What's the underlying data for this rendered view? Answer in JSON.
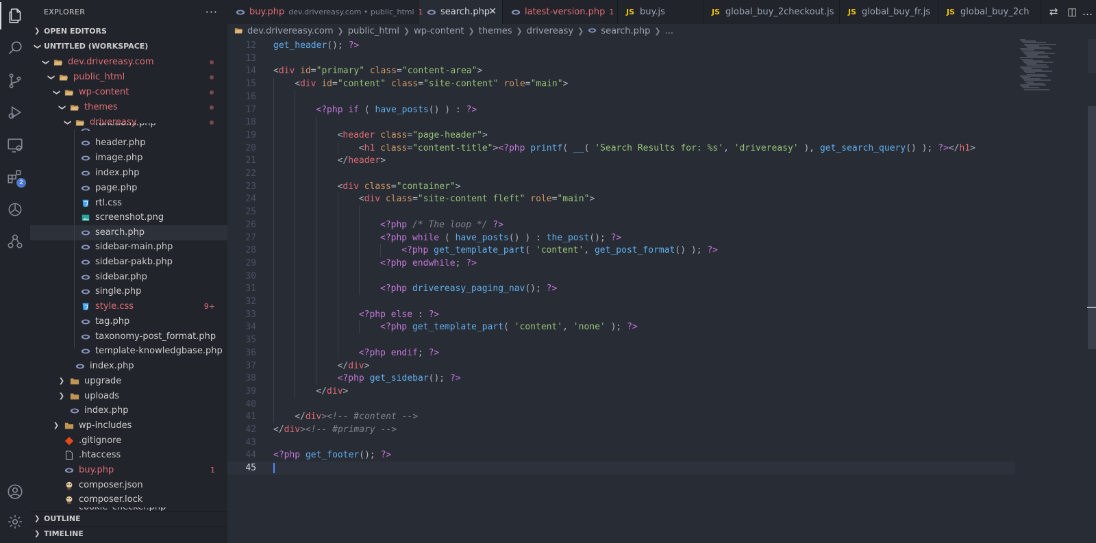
{
  "activity_bar": {
    "items": [
      {
        "name": "explorer-icon",
        "active": true
      },
      {
        "name": "search-icon"
      },
      {
        "name": "source-control-icon"
      },
      {
        "name": "run-debug-icon"
      },
      {
        "name": "remote-explorer-icon"
      },
      {
        "name": "extensions-icon",
        "badge": "2"
      },
      {
        "name": "chatgpt-icon"
      },
      {
        "name": "bug-tree-icon"
      }
    ],
    "bottom": [
      {
        "name": "account-icon"
      },
      {
        "name": "settings-gear-icon"
      }
    ]
  },
  "sidebar": {
    "title": "EXPLORER",
    "more": "···",
    "open_editors": "OPEN EDITORS",
    "workspace": "UNTITLED (WORKSPACE)",
    "tree": [
      {
        "label": "dev.drivereasy.com",
        "type": "folder-open",
        "depth": 1,
        "mod": true,
        "dot": true
      },
      {
        "label": "public_html",
        "type": "folder-open",
        "depth": 2,
        "mod": true,
        "dot": true
      },
      {
        "label": "wp-content",
        "type": "folder-open",
        "depth": 3,
        "mod": true,
        "dot": true
      },
      {
        "label": "themes",
        "type": "folder-open",
        "depth": 4,
        "mod": true,
        "dot": true
      },
      {
        "label": "drivereasy",
        "type": "folder-open",
        "depth": 5,
        "mod": true,
        "dot": true
      },
      {
        "label": "functions.php",
        "type": "php",
        "depth": 6,
        "partial": true
      },
      {
        "label": "header.php",
        "type": "php",
        "depth": 6
      },
      {
        "label": "image.php",
        "type": "php",
        "depth": 6
      },
      {
        "label": "index.php",
        "type": "php",
        "depth": 6
      },
      {
        "label": "page.php",
        "type": "php",
        "depth": 6
      },
      {
        "label": "rtl.css",
        "type": "css",
        "depth": 6
      },
      {
        "label": "screenshot.png",
        "type": "png",
        "depth": 6
      },
      {
        "label": "search.php",
        "type": "php",
        "depth": 6,
        "active": true
      },
      {
        "label": "sidebar-main.php",
        "type": "php",
        "depth": 6
      },
      {
        "label": "sidebar-pakb.php",
        "type": "php",
        "depth": 6
      },
      {
        "label": "sidebar.php",
        "type": "php",
        "depth": 6
      },
      {
        "label": "single.php",
        "type": "php",
        "depth": 6
      },
      {
        "label": "style.css",
        "type": "css",
        "depth": 6,
        "mod": true,
        "count": "9+"
      },
      {
        "label": "tag.php",
        "type": "php",
        "depth": 6
      },
      {
        "label": "taxonomy-post_format.php",
        "type": "php",
        "depth": 6
      },
      {
        "label": "template-knowledgbase.php",
        "type": "php",
        "depth": 6
      },
      {
        "label": "index.php",
        "type": "php",
        "depth": 5
      },
      {
        "label": "upgrade",
        "type": "folder",
        "depth": 4
      },
      {
        "label": "uploads",
        "type": "folder",
        "depth": 4
      },
      {
        "label": "index.php",
        "type": "php",
        "depth": 4
      },
      {
        "label": "wp-includes",
        "type": "folder",
        "depth": 3
      },
      {
        "label": ".gitignore",
        "type": "git",
        "depth": 3
      },
      {
        "label": ".htaccess",
        "type": "file",
        "depth": 3
      },
      {
        "label": "buy.php",
        "type": "php",
        "depth": 3,
        "mod": true,
        "count": "1"
      },
      {
        "label": "composer.json",
        "type": "composer",
        "depth": 3
      },
      {
        "label": "composer.lock",
        "type": "composer",
        "depth": 3
      },
      {
        "label": "cookie_checker.php",
        "type": "php",
        "depth": 3,
        "partial": true
      }
    ],
    "outline": "OUTLINE",
    "timeline": "TIMELINE"
  },
  "tabs": [
    {
      "name": "buy.php",
      "desc": "dev.drivereasy.com • public_html",
      "num": "1",
      "icon": "php",
      "mod": true
    },
    {
      "name": "search.php",
      "icon": "php",
      "active": true,
      "close": "✕"
    },
    {
      "name": "latest-version.php",
      "num": "1",
      "icon": "php",
      "mod": true
    },
    {
      "name": "buy.js",
      "icon": "js"
    },
    {
      "name": "global_buy_2checkout.js",
      "icon": "js"
    },
    {
      "name": "global_buy_fr.js",
      "icon": "js"
    },
    {
      "name": "global_buy_2ch",
      "icon": "js"
    }
  ],
  "js_badge": "JS",
  "breadcrumb": [
    "dev.drivereasy.com",
    "public_html",
    "wp-content",
    "themes",
    "drivereasy",
    "search.php",
    "..."
  ],
  "editor": {
    "current_line": "45",
    "lines": [
      {
        "n": "12",
        "indent": 0,
        "toks": [
          [
            "t-fn",
            "get_header"
          ],
          [
            "t-pl",
            "(); "
          ],
          [
            "t-kw",
            "?>"
          ]
        ]
      },
      {
        "n": "13",
        "indent": 0,
        "toks": []
      },
      {
        "n": "14",
        "indent": 0,
        "toks": [
          [
            "t-pl",
            "<"
          ],
          [
            "t-tag",
            "div"
          ],
          [
            "t-pl",
            " "
          ],
          [
            "t-attr",
            "id"
          ],
          [
            "t-pl",
            "="
          ],
          [
            "t-str",
            "\"primary\""
          ],
          [
            "t-pl",
            " "
          ],
          [
            "t-attr",
            "class"
          ],
          [
            "t-pl",
            "="
          ],
          [
            "t-str",
            "\"content-area\""
          ],
          [
            "t-pl",
            ">"
          ]
        ]
      },
      {
        "n": "15",
        "indent": 1,
        "toks": [
          [
            "t-pl",
            "<"
          ],
          [
            "t-tag",
            "div"
          ],
          [
            "t-pl",
            " "
          ],
          [
            "t-attr",
            "id"
          ],
          [
            "t-pl",
            "="
          ],
          [
            "t-str",
            "\"content\""
          ],
          [
            "t-pl",
            " "
          ],
          [
            "t-attr",
            "class"
          ],
          [
            "t-pl",
            "="
          ],
          [
            "t-str",
            "\"site-content\""
          ],
          [
            "t-pl",
            " "
          ],
          [
            "t-attr",
            "role"
          ],
          [
            "t-pl",
            "="
          ],
          [
            "t-str",
            "\"main\""
          ],
          [
            "t-pl",
            ">"
          ]
        ]
      },
      {
        "n": "16",
        "indent": 2,
        "toks": []
      },
      {
        "n": "17",
        "indent": 2,
        "toks": [
          [
            "t-kw",
            "<?php"
          ],
          [
            "t-pl",
            " "
          ],
          [
            "t-kw",
            "if"
          ],
          [
            "t-pl",
            " ( "
          ],
          [
            "t-fn",
            "have_posts"
          ],
          [
            "t-pl",
            "() ) : "
          ],
          [
            "t-kw",
            "?>"
          ]
        ]
      },
      {
        "n": "18",
        "indent": 3,
        "toks": []
      },
      {
        "n": "19",
        "indent": 3,
        "toks": [
          [
            "t-pl",
            "<"
          ],
          [
            "t-tag",
            "header"
          ],
          [
            "t-pl",
            " "
          ],
          [
            "t-attr",
            "class"
          ],
          [
            "t-pl",
            "="
          ],
          [
            "t-str",
            "\"page-header\""
          ],
          [
            "t-pl",
            ">"
          ]
        ]
      },
      {
        "n": "20",
        "indent": 4,
        "toks": [
          [
            "t-pl",
            "<"
          ],
          [
            "t-tag",
            "h1"
          ],
          [
            "t-pl",
            " "
          ],
          [
            "t-attr",
            "class"
          ],
          [
            "t-pl",
            "="
          ],
          [
            "t-str",
            "\"content-title\""
          ],
          [
            "t-pl",
            ">"
          ],
          [
            "t-kw",
            "<?php"
          ],
          [
            "t-pl",
            " "
          ],
          [
            "t-fn",
            "printf"
          ],
          [
            "t-pl",
            "( "
          ],
          [
            "t-fn",
            "__"
          ],
          [
            "t-pl",
            "( "
          ],
          [
            "t-str",
            "'Search Results for: %s'"
          ],
          [
            "t-pl",
            ", "
          ],
          [
            "t-str",
            "'drivereasy'"
          ],
          [
            "t-pl",
            " ), "
          ],
          [
            "t-fn",
            "get_search_query"
          ],
          [
            "t-pl",
            "() ); "
          ],
          [
            "t-kw",
            "?>"
          ],
          [
            "t-pl",
            "</"
          ],
          [
            "t-tag",
            "h1"
          ],
          [
            "t-pl",
            ">"
          ]
        ]
      },
      {
        "n": "21",
        "indent": 3,
        "toks": [
          [
            "t-pl",
            "</"
          ],
          [
            "t-tag",
            "header"
          ],
          [
            "t-pl",
            ">"
          ]
        ]
      },
      {
        "n": "22",
        "indent": 3,
        "toks": []
      },
      {
        "n": "23",
        "indent": 3,
        "toks": [
          [
            "t-pl",
            "<"
          ],
          [
            "t-tag",
            "div"
          ],
          [
            "t-pl",
            " "
          ],
          [
            "t-attr",
            "class"
          ],
          [
            "t-pl",
            "="
          ],
          [
            "t-str",
            "\"container\""
          ],
          [
            "t-pl",
            ">"
          ]
        ]
      },
      {
        "n": "24",
        "indent": 4,
        "toks": [
          [
            "t-pl",
            "<"
          ],
          [
            "t-tag",
            "div"
          ],
          [
            "t-pl",
            " "
          ],
          [
            "t-attr",
            "class"
          ],
          [
            "t-pl",
            "="
          ],
          [
            "t-str",
            "\"site-content fleft\""
          ],
          [
            "t-pl",
            " "
          ],
          [
            "t-attr",
            "role"
          ],
          [
            "t-pl",
            "="
          ],
          [
            "t-str",
            "\"main\""
          ],
          [
            "t-pl",
            ">"
          ]
        ]
      },
      {
        "n": "25",
        "indent": 5,
        "toks": []
      },
      {
        "n": "26",
        "indent": 5,
        "toks": [
          [
            "t-kw",
            "<?php"
          ],
          [
            "t-pl",
            " "
          ],
          [
            "t-com",
            "/* The loop */"
          ],
          [
            "t-pl",
            " "
          ],
          [
            "t-kw",
            "?>"
          ]
        ]
      },
      {
        "n": "27",
        "indent": 5,
        "toks": [
          [
            "t-kw",
            "<?php"
          ],
          [
            "t-pl",
            " "
          ],
          [
            "t-kw",
            "while"
          ],
          [
            "t-pl",
            " ( "
          ],
          [
            "t-fn",
            "have_posts"
          ],
          [
            "t-pl",
            "() ) : "
          ],
          [
            "t-fn",
            "the_post"
          ],
          [
            "t-pl",
            "(); "
          ],
          [
            "t-kw",
            "?>"
          ]
        ]
      },
      {
        "n": "28",
        "indent": 6,
        "toks": [
          [
            "t-kw",
            "<?php"
          ],
          [
            "t-pl",
            " "
          ],
          [
            "t-fn",
            "get_template_part"
          ],
          [
            "t-pl",
            "( "
          ],
          [
            "t-str",
            "'content'"
          ],
          [
            "t-pl",
            ", "
          ],
          [
            "t-fn",
            "get_post_format"
          ],
          [
            "t-pl",
            "() ); "
          ],
          [
            "t-kw",
            "?>"
          ]
        ]
      },
      {
        "n": "29",
        "indent": 5,
        "toks": [
          [
            "t-kw",
            "<?php"
          ],
          [
            "t-pl",
            " "
          ],
          [
            "t-kw",
            "endwhile"
          ],
          [
            "t-pl",
            "; "
          ],
          [
            "t-kw",
            "?>"
          ]
        ]
      },
      {
        "n": "30",
        "indent": 5,
        "toks": []
      },
      {
        "n": "31",
        "indent": 5,
        "toks": [
          [
            "t-kw",
            "<?php"
          ],
          [
            "t-pl",
            " "
          ],
          [
            "t-fn",
            "drivereasy_paging_nav"
          ],
          [
            "t-pl",
            "(); "
          ],
          [
            "t-kw",
            "?>"
          ]
        ]
      },
      {
        "n": "32",
        "indent": 4,
        "toks": []
      },
      {
        "n": "33",
        "indent": 4,
        "toks": [
          [
            "t-kw",
            "<?php"
          ],
          [
            "t-pl",
            " "
          ],
          [
            "t-kw",
            "else"
          ],
          [
            "t-pl",
            " : "
          ],
          [
            "t-kw",
            "?>"
          ]
        ]
      },
      {
        "n": "34",
        "indent": 5,
        "toks": [
          [
            "t-kw",
            "<?php"
          ],
          [
            "t-pl",
            " "
          ],
          [
            "t-fn",
            "get_template_part"
          ],
          [
            "t-pl",
            "( "
          ],
          [
            "t-str",
            "'content'"
          ],
          [
            "t-pl",
            ", "
          ],
          [
            "t-str",
            "'none'"
          ],
          [
            "t-pl",
            " ); "
          ],
          [
            "t-kw",
            "?>"
          ]
        ]
      },
      {
        "n": "35",
        "indent": 4,
        "toks": []
      },
      {
        "n": "36",
        "indent": 4,
        "toks": [
          [
            "t-kw",
            "<?php"
          ],
          [
            "t-pl",
            " "
          ],
          [
            "t-kw",
            "endif"
          ],
          [
            "t-pl",
            "; "
          ],
          [
            "t-kw",
            "?>"
          ]
        ]
      },
      {
        "n": "37",
        "indent": 3,
        "toks": [
          [
            "t-pl",
            "</"
          ],
          [
            "t-tag",
            "div"
          ],
          [
            "t-pl",
            ">"
          ]
        ]
      },
      {
        "n": "38",
        "indent": 3,
        "toks": [
          [
            "t-kw",
            "<?php"
          ],
          [
            "t-pl",
            " "
          ],
          [
            "t-fn",
            "get_sidebar"
          ],
          [
            "t-pl",
            "(); "
          ],
          [
            "t-kw",
            "?>"
          ]
        ]
      },
      {
        "n": "39",
        "indent": 2,
        "toks": [
          [
            "t-pl",
            "</"
          ],
          [
            "t-tag",
            "div"
          ],
          [
            "t-pl",
            ">"
          ]
        ]
      },
      {
        "n": "40",
        "indent": 1,
        "toks": []
      },
      {
        "n": "41",
        "indent": 1,
        "toks": [
          [
            "t-pl",
            "</"
          ],
          [
            "t-tag",
            "div"
          ],
          [
            "t-com",
            "><!-- #content -->"
          ]
        ]
      },
      {
        "n": "42",
        "indent": 0,
        "toks": [
          [
            "t-pl",
            "</"
          ],
          [
            "t-tag",
            "div"
          ],
          [
            "t-com",
            "><!-- #primary -->"
          ]
        ]
      },
      {
        "n": "43",
        "indent": 0,
        "toks": []
      },
      {
        "n": "44",
        "indent": 0,
        "toks": [
          [
            "t-kw",
            "<?php"
          ],
          [
            "t-pl",
            " "
          ],
          [
            "t-fn",
            "get_footer"
          ],
          [
            "t-pl",
            "(); "
          ],
          [
            "t-kw",
            "?>"
          ]
        ]
      },
      {
        "n": "45",
        "indent": 0,
        "toks": []
      }
    ]
  }
}
